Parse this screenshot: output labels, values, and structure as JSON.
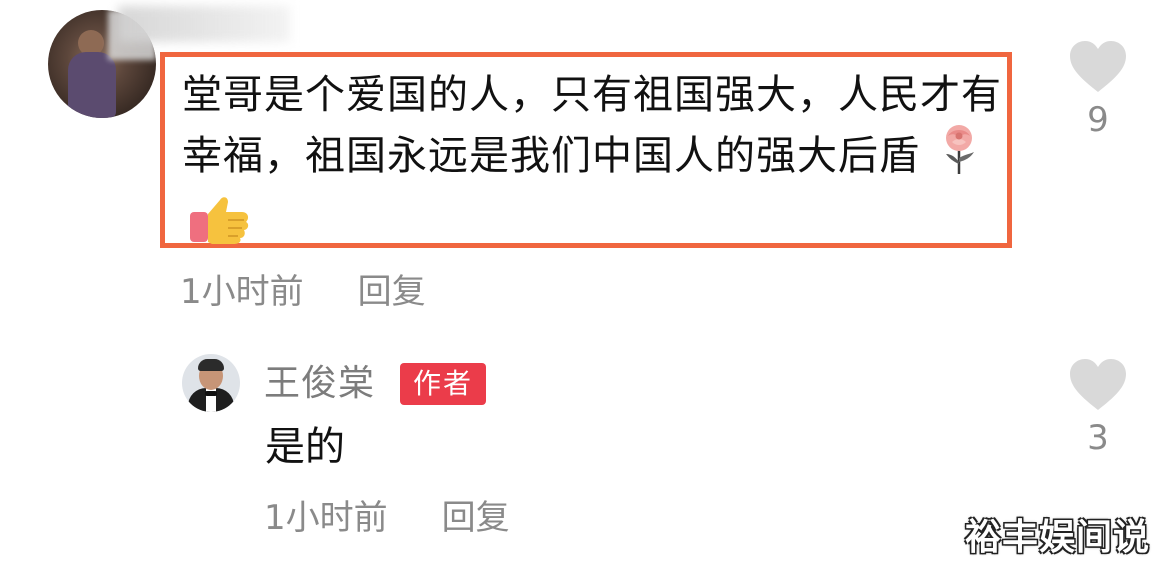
{
  "comment": {
    "text": "堂哥是个爱国的人，只有祖国强大，人民才有幸福，祖国永远是我们中国人的强大后盾",
    "emojis": [
      "rose-icon",
      "thumbs-up-icon"
    ],
    "time": "1小时前",
    "reply_label": "回复",
    "likes": "9"
  },
  "reply": {
    "username": "王俊棠",
    "badge": "作者",
    "text": "是的",
    "time": "1小时前",
    "reply_label": "回复",
    "likes": "3"
  },
  "watermark": "裕丰娱间说",
  "colors": {
    "highlight_border": "#f0663f",
    "badge_bg": "#eb3c4a",
    "meta_text": "#8a8a8a",
    "like_icon": "#d9d9d9"
  }
}
